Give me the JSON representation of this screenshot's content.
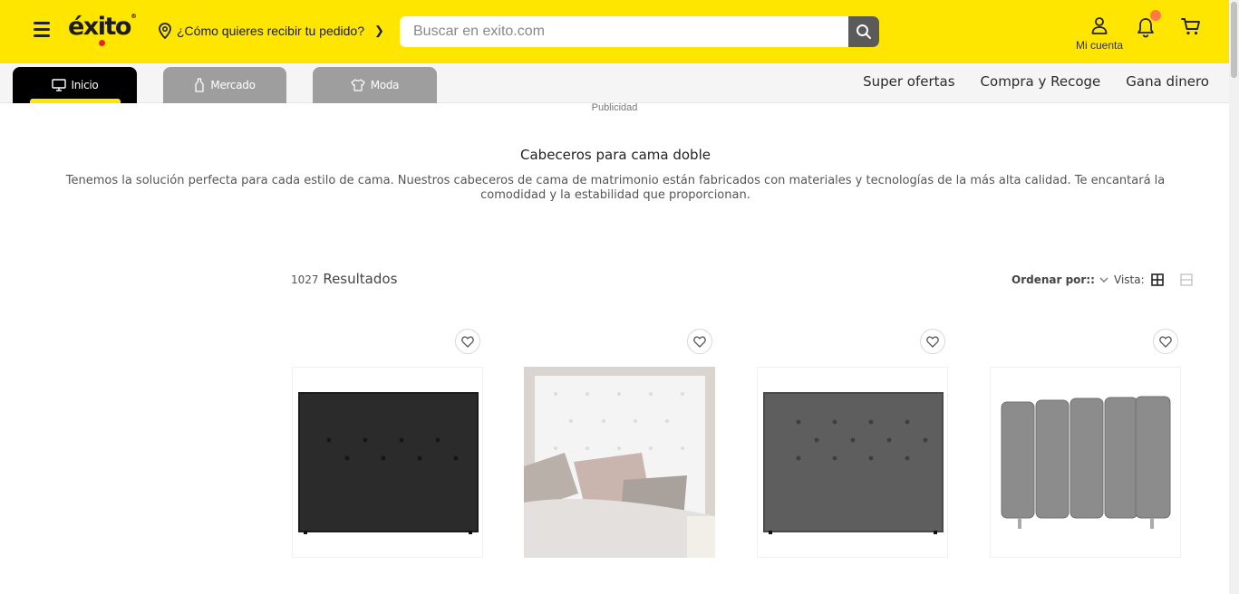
{
  "header": {
    "logo_text": "éxito",
    "logo_reg": "®",
    "delivery_text": "¿Cómo quieres recibir tu pedido?",
    "search_placeholder": "Buscar en exito.com",
    "account_label": "Mi cuenta",
    "accent_color": "#ffe600"
  },
  "nav": {
    "tabs": [
      {
        "label": "Inicio",
        "icon": "monitor-icon",
        "active": true
      },
      {
        "label": "Mercado",
        "icon": "bottle-icon",
        "active": false
      },
      {
        "label": "Moda",
        "icon": "shirt-icon",
        "active": false
      }
    ],
    "links": [
      "Super ofertas",
      "Compra y Recoge",
      "Gana dinero"
    ]
  },
  "publicidad": "Publicidad",
  "category": {
    "title": "Cabeceros para cama doble",
    "description": "Tenemos la solución perfecta para cada estilo de cama. Nuestros cabeceros de cama de matrimonio están fabricados con materiales y tecnologías de la más alta calidad. Te encantará la comodidad y la estabilidad que proporcionan."
  },
  "results": {
    "count": "1027",
    "label": "Resultados",
    "sort_label": "Ordenar por::",
    "view_label": "Vista:"
  },
  "products": [
    {
      "name": "black-tufted-headboard",
      "color": "#2a2a2a"
    },
    {
      "name": "white-tufted-headboard-photo",
      "color": "#f2f2f2"
    },
    {
      "name": "gray-tufted-headboard",
      "color": "#5c5c5c"
    },
    {
      "name": "gray-channel-headboard",
      "color": "#8a8a8a"
    }
  ]
}
